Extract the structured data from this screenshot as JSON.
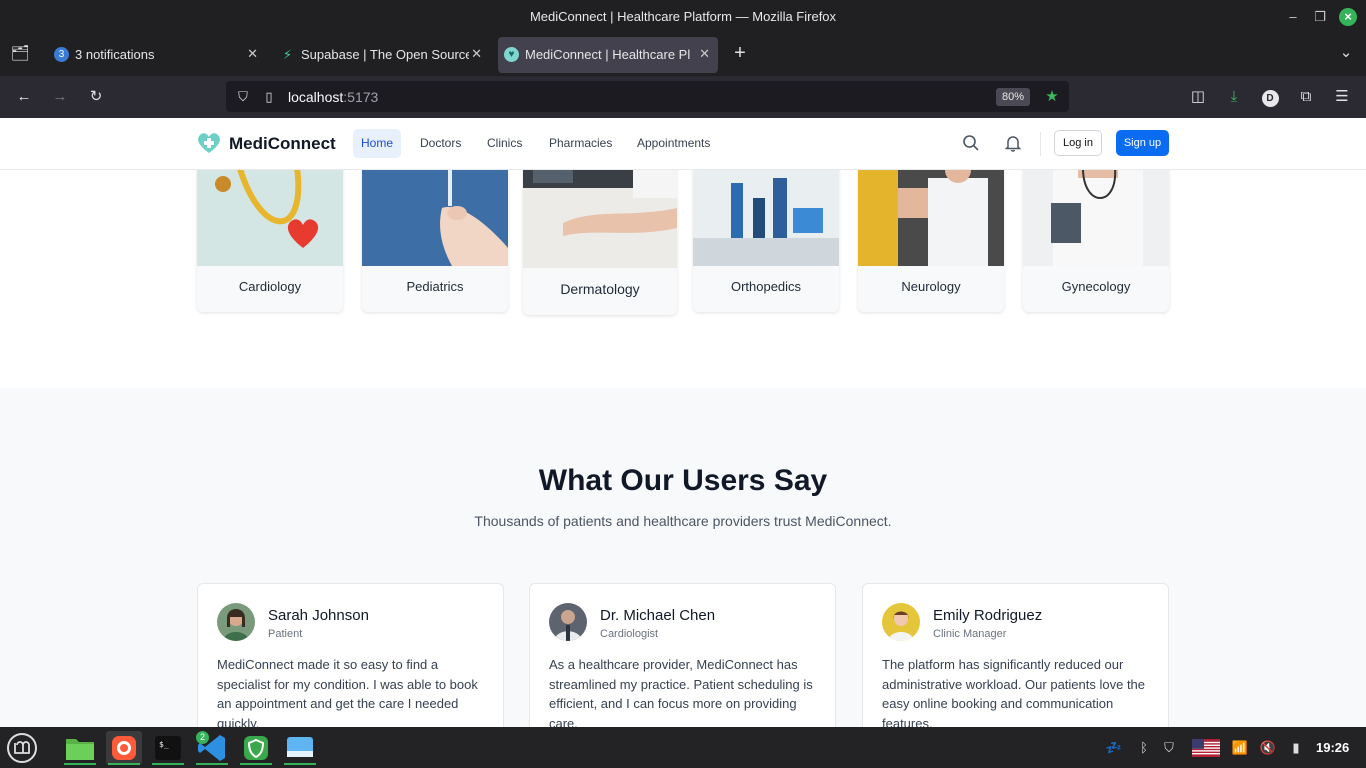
{
  "window": {
    "title": "MediConnect | Healthcare Platform — Mozilla Firefox"
  },
  "tabs": [
    {
      "label": "3 notifications",
      "badge": "3"
    },
    {
      "label": "Supabase | The Open Source"
    },
    {
      "label": "MediConnect | Healthcare Pl"
    }
  ],
  "navbar": {
    "url_host": "localhost",
    "url_port": ":5173",
    "zoom": "80%",
    "account_initial": "D"
  },
  "site": {
    "brand": "MediConnect",
    "nav": [
      "Home",
      "Doctors",
      "Clinics",
      "Pharmacies",
      "Appointments"
    ],
    "login": "Log in",
    "signup": "Sign up"
  },
  "specialties": [
    "Cardiology",
    "Pediatrics",
    "Dermatology",
    "Orthopedics",
    "Neurology",
    "Gynecology"
  ],
  "testimonials": {
    "heading": "What Our Users Say",
    "subheading": "Thousands of patients and healthcare providers trust MediConnect.",
    "items": [
      {
        "name": "Sarah Johnson",
        "role": "Patient",
        "quote": "MediConnect made it so easy to find a specialist for my condition. I was able to book an appointment and get the care I needed quickly."
      },
      {
        "name": "Dr. Michael Chen",
        "role": "Cardiologist",
        "quote": "As a healthcare provider, MediConnect has streamlined my practice. Patient scheduling is efficient, and I can focus more on providing care."
      },
      {
        "name": "Emily Rodriguez",
        "role": "Clinic Manager",
        "quote": "The platform has significantly reduced our administrative workload. Our patients love the easy online booking and communication features."
      }
    ]
  },
  "taskbar": {
    "vscode_badge": "2",
    "clock": "19:26"
  }
}
